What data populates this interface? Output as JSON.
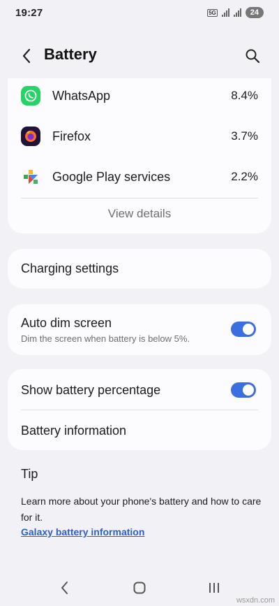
{
  "status_bar": {
    "time": "19:27",
    "network": "5G",
    "battery": "24"
  },
  "header": {
    "title": "Battery",
    "back_icon": "back-arrow-icon",
    "search_icon": "search-icon"
  },
  "apps": [
    {
      "name": "WhatsApp",
      "percent": "8.4%",
      "icon": "whatsapp-icon",
      "color": "#25d366"
    },
    {
      "name": "Firefox",
      "percent": "3.7%",
      "icon": "firefox-icon",
      "color": "#20123a"
    },
    {
      "name": "Google Play services",
      "percent": "2.2%",
      "icon": "google-play-services-icon",
      "color": "#34a853"
    }
  ],
  "view_details": "View details",
  "settings": {
    "charging": "Charging settings",
    "auto_dim": {
      "label": "Auto dim screen",
      "description": "Dim the screen when battery is below 5%.",
      "enabled": true
    },
    "show_percentage": {
      "label": "Show battery percentage",
      "enabled": true
    },
    "battery_information": "Battery information"
  },
  "tip": {
    "title": "Tip",
    "text": "Learn more about your phone's battery and how to care for it.",
    "link": "Galaxy battery information"
  },
  "watermark": "wsxdn.com",
  "colors": {
    "accent": "#3b6fe0",
    "link": "#2f5ec9",
    "background": "#f2f1f6",
    "card": "#fcfcfe"
  }
}
